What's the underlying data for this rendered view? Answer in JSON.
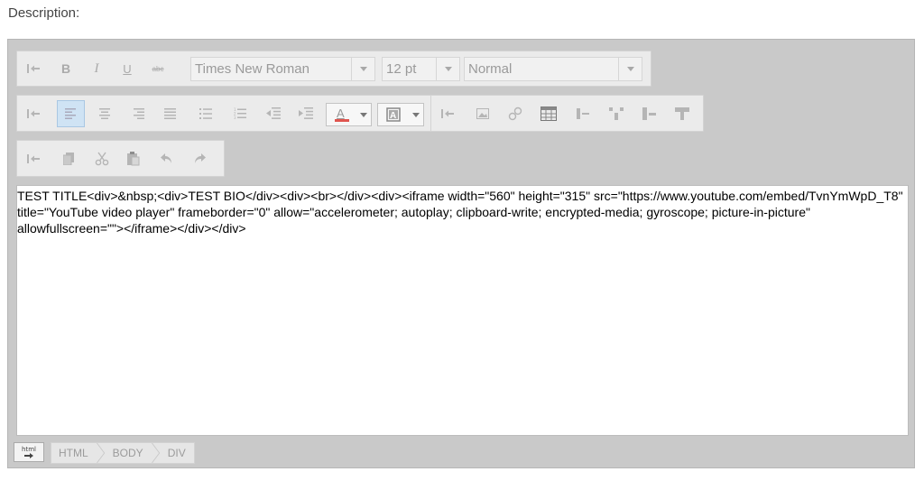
{
  "page": {
    "description_label": "Description:"
  },
  "toolbar": {
    "row1": {
      "font_family": "Times New Roman",
      "font_size": "12 pt",
      "block_format": "Normal",
      "bold": "B",
      "italic": "I",
      "underline": "U",
      "strikethrough": "abc"
    },
    "text_color_accent": "#e0554f"
  },
  "editor": {
    "content": "TEST TITLE<div>&nbsp;<div>TEST BIO</div><div><br></div><div><iframe width=\"560\" height=\"315\" src=\"https://www.youtube.com/embed/TvnYmWpD_T8\" title=\"YouTube video player\" frameborder=\"0\" allow=\"accelerometer; autoplay; clipboard-write; encrypted-media; gyroscope; picture-in-picture\" allowfullscreen=\"\"></iframe></div></div>"
  },
  "statusbar": {
    "html_toggle": "html",
    "breadcrumbs": [
      "HTML",
      "BODY",
      "DIV"
    ]
  }
}
